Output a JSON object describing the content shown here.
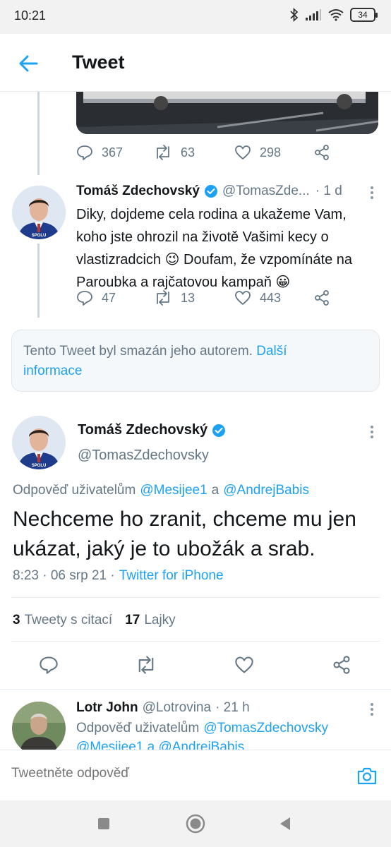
{
  "status_bar": {
    "time": "10:21",
    "battery": "34"
  },
  "header": {
    "title": "Tweet"
  },
  "previous_tweet_actions": {
    "replies": "367",
    "retweets": "63",
    "likes": "298"
  },
  "reply_tweet": {
    "name": "Tomáš Zdechovský",
    "handle": "@TomasZde...",
    "time": "· 1 d",
    "lines": [
      "Diky, dojdeme cela rodina a ukažeme Vam,",
      "koho jste ohrozil na životě Vašimi kecy o",
      "vlastizradcich 😉 Doufam, že vzpomínáte na",
      "Paroubka a rajčatovou kampaň 😀"
    ],
    "replies": "47",
    "retweets": "13",
    "likes": "443"
  },
  "deleted_notice": {
    "text": "Tento Tweet byl smazán jeho autorem.",
    "link": "Další",
    "link2": "informace"
  },
  "main_tweet": {
    "name": "Tomáš Zdechovský",
    "handle": "@TomasZdechovsky",
    "reply_prefix": "Odpověď uživatelům",
    "reply_user1": "@Mesijee1",
    "reply_and": "a",
    "reply_user2": "@AndrejBabis",
    "text_line1": "Nechceme ho zranit, chceme mu jen",
    "text_line2": "ukázat, jaký je to ubožák a srab.",
    "timestamp": "8:23 · 06 srp 21 ·",
    "source": "Twitter for iPhone",
    "quote_count": "3",
    "quote_label": "Tweety s citací",
    "like_count": "17",
    "like_label": "Lajky"
  },
  "next_reply": {
    "name": "Lotr John",
    "handle": "@Lotrovina",
    "time": "· 21 h",
    "reply_prefix": "Odpověď uživatelům",
    "reply_user1": "@TomasZdechovsky",
    "line2": "@Mesijee1 a @AndrejBabis"
  },
  "reply_bar": {
    "placeholder": "Tweetněte odpověď"
  },
  "colors": {
    "accent": "#1da1f2",
    "secondary_text": "#657786",
    "verified": "#1da1f2"
  }
}
